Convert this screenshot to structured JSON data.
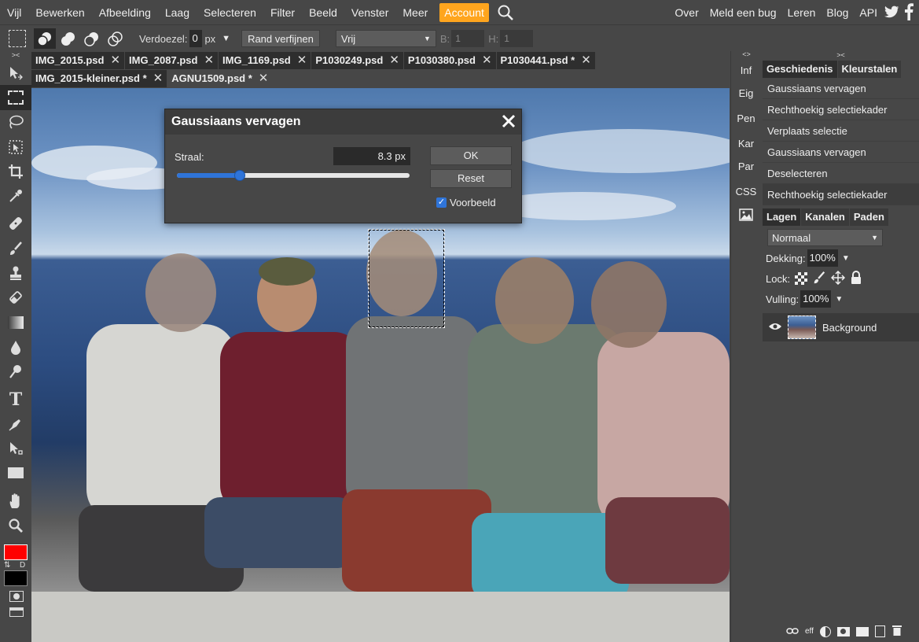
{
  "menu": {
    "items": [
      "Vijl",
      "Bewerken",
      "Afbeelding",
      "Laag",
      "Selecteren",
      "Filter",
      "Beeld",
      "Venster",
      "Meer"
    ],
    "account": "Account",
    "right": [
      "Over",
      "Meld een bug",
      "Leren",
      "Blog",
      "API"
    ],
    "accent_color": "#ffa51e"
  },
  "options": {
    "feather_label": "Verdoezel:",
    "feather_value": "0",
    "feather_unit": "px",
    "refine_edge": "Rand verfijnen",
    "style_value": "Vrij",
    "width_label": "B:",
    "width_value": "1",
    "height_label": "H:",
    "height_value": "1"
  },
  "tabs": {
    "row1": [
      "IMG_2015.psd",
      "IMG_2087.psd",
      "IMG_1169.psd",
      "P1030249.psd",
      "P1030380.psd",
      "P1030441.psd *"
    ],
    "row2": [
      "IMG_2015-kleiner.psd *",
      "AGNU1509.psd *"
    ],
    "close_glyph": "✕"
  },
  "mid_panel": {
    "collapse": "<>",
    "items": [
      "Inf",
      "Eig",
      "Pen",
      "Kar",
      "Par",
      "CSS"
    ]
  },
  "history_panel": {
    "collapse": "><",
    "tabs": [
      "Geschiedenis",
      "Kleurstalen"
    ],
    "items": [
      "Gaussiaans vervagen",
      "Rechthoekig selectiekader",
      "Verplaats selectie",
      "Gaussiaans vervagen",
      "Deselecteren",
      "Rechthoekig selectiekader"
    ]
  },
  "layers_panel": {
    "tabs": [
      "Lagen",
      "Kanalen",
      "Paden"
    ],
    "blend_mode": "Normaal",
    "opacity_label": "Dekking:",
    "opacity_value": "100%",
    "lock_label": "Lock:",
    "fill_label": "Vulling:",
    "fill_value": "100%",
    "layer_name": "Background",
    "footer_fx": "eff"
  },
  "colors": {
    "foreground": "#ff0000",
    "background": "#000000",
    "swap": "⇅",
    "default": "D"
  },
  "dialog": {
    "title": "Gaussiaans vervagen",
    "radius_label": "Straal:",
    "radius_value": "8.3 px",
    "radius_fraction": 0.27,
    "ok": "OK",
    "reset": "Reset",
    "preview_label": "Voorbeeld",
    "preview_checked": true
  }
}
